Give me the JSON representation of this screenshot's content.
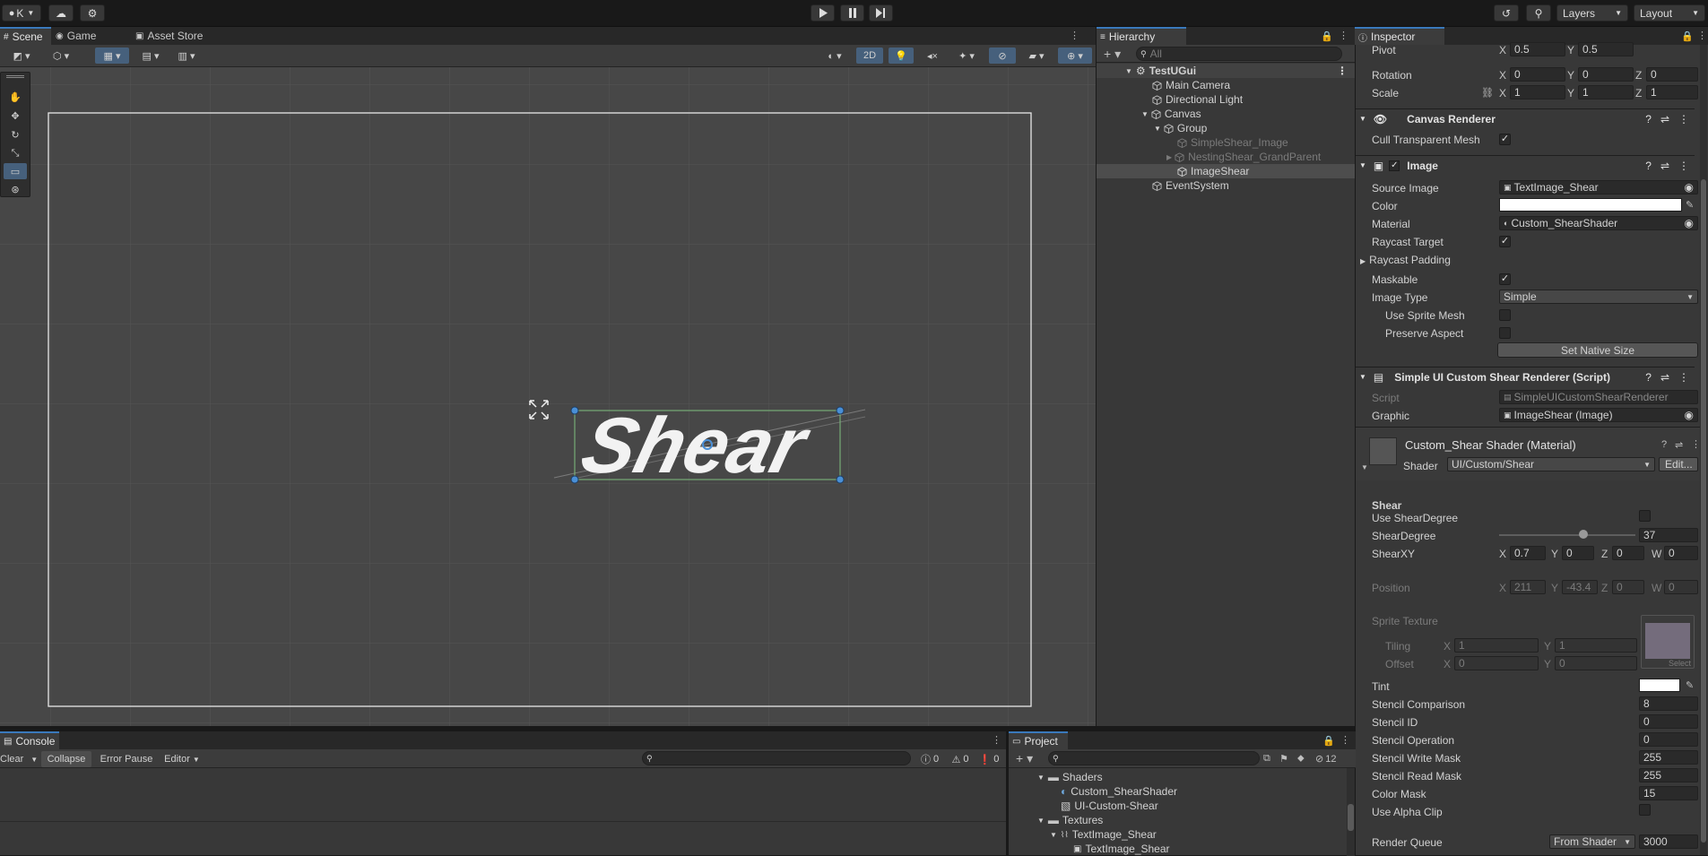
{
  "topbar": {
    "account": "K",
    "layers_label": "Layers",
    "layout_label": "Layout"
  },
  "scene_tabs": [
    {
      "label": "Scene"
    },
    {
      "label": "Game"
    },
    {
      "label": "Asset Store"
    }
  ],
  "scene_toolbar": {
    "mode_2d": "2D"
  },
  "scene": {
    "shear_text": "Shear"
  },
  "hierarchy": {
    "tab_label": "Hierarchy",
    "search_placeholder": "All",
    "items": [
      {
        "label": "TestUGui"
      },
      {
        "label": "Main Camera"
      },
      {
        "label": "Directional Light"
      },
      {
        "label": "Canvas"
      },
      {
        "label": "Group"
      },
      {
        "label": "SimpleShear_Image"
      },
      {
        "label": "NestingShear_GrandParent"
      },
      {
        "label": "ImageShear"
      },
      {
        "label": "EventSystem"
      }
    ]
  },
  "inspector": {
    "tab_label": "Inspector",
    "transform": {
      "pivot_label": "Pivot",
      "pivot_x": "0.5",
      "pivot_y": "0.5",
      "rotation_label": "Rotation",
      "rot_x": "0",
      "rot_y": "0",
      "rot_z": "0",
      "scale_label": "Scale",
      "scale_x": "1",
      "scale_y": "1",
      "scale_z": "1"
    },
    "canvas_renderer": {
      "title": "Canvas Renderer",
      "cull_label": "Cull Transparent Mesh"
    },
    "image": {
      "title": "Image",
      "source_image_label": "Source Image",
      "source_image": "TextImage_Shear",
      "color_label": "Color",
      "material_label": "Material",
      "material": "Custom_ShearShader",
      "raycast_target_label": "Raycast Target",
      "raycast_padding_label": "Raycast Padding",
      "maskable_label": "Maskable",
      "image_type_label": "Image Type",
      "image_type": "Simple",
      "use_sprite_mesh_label": "Use Sprite Mesh",
      "preserve_aspect_label": "Preserve Aspect",
      "set_native_size": "Set Native Size"
    },
    "script_comp": {
      "title": "Simple UI Custom Shear Renderer (Script)",
      "script_label": "Script",
      "script": "SimpleUICustomShearRenderer",
      "graphic_label": "Graphic",
      "graphic": "ImageShear (Image)"
    },
    "material": {
      "title": "Custom_Shear Shader (Material)",
      "shader_label": "Shader",
      "shader": "UI/Custom/Shear",
      "edit_button": "Edit...",
      "section": "Shear",
      "use_shear_degree_label": "Use ShearDegree",
      "shear_degree_label": "ShearDegree",
      "shear_degree": "37",
      "shear_degree_fraction": 0.62,
      "shear_xy_label": "ShearXY",
      "sxy_x": "0.7",
      "sxy_y": "0",
      "sxy_z": "0",
      "sxy_w": "0",
      "position_label": "Position",
      "pos_x": "211",
      "pos_y": "-43.4",
      "pos_z": "0",
      "pos_w": "0",
      "sprite_texture_label": "Sprite Texture",
      "tiling_label": "Tiling",
      "tiling_x": "1",
      "tiling_y": "1",
      "offset_label": "Offset",
      "offset_x": "0",
      "offset_y": "0",
      "select_label": "Select",
      "tint_label": "Tint",
      "stencil_comparison_label": "Stencil Comparison",
      "stencil_comparison": "8",
      "stencil_id_label": "Stencil ID",
      "stencil_id": "0",
      "stencil_operation_label": "Stencil Operation",
      "stencil_operation": "0",
      "stencil_write_mask_label": "Stencil Write Mask",
      "stencil_write_mask": "255",
      "stencil_read_mask_label": "Stencil Read Mask",
      "stencil_read_mask": "255",
      "color_mask_label": "Color Mask",
      "color_mask": "15",
      "use_alpha_clip_label": "Use Alpha Clip",
      "render_queue_label": "Render Queue",
      "render_queue_mode": "From Shader",
      "render_queue": "3000"
    }
  },
  "console": {
    "tab_label": "Console",
    "clear": "Clear",
    "collapse": "Collapse",
    "error_pause": "Error Pause",
    "editor": "Editor",
    "count_log": "0",
    "count_warn": "0",
    "count_err": "0"
  },
  "project": {
    "tab_label": "Project",
    "hidden_count": "12",
    "items": [
      {
        "label": "Shaders"
      },
      {
        "label": "Custom_ShearShader"
      },
      {
        "label": "UI-Custom-Shear"
      },
      {
        "label": "Textures"
      },
      {
        "label": "TextImage_Shear"
      },
      {
        "label": "TextImage_Shear"
      }
    ]
  },
  "colors": {
    "accent_blue": "#3a79bb",
    "selection_blue": "#46607c",
    "scene_bg": "#474747"
  }
}
